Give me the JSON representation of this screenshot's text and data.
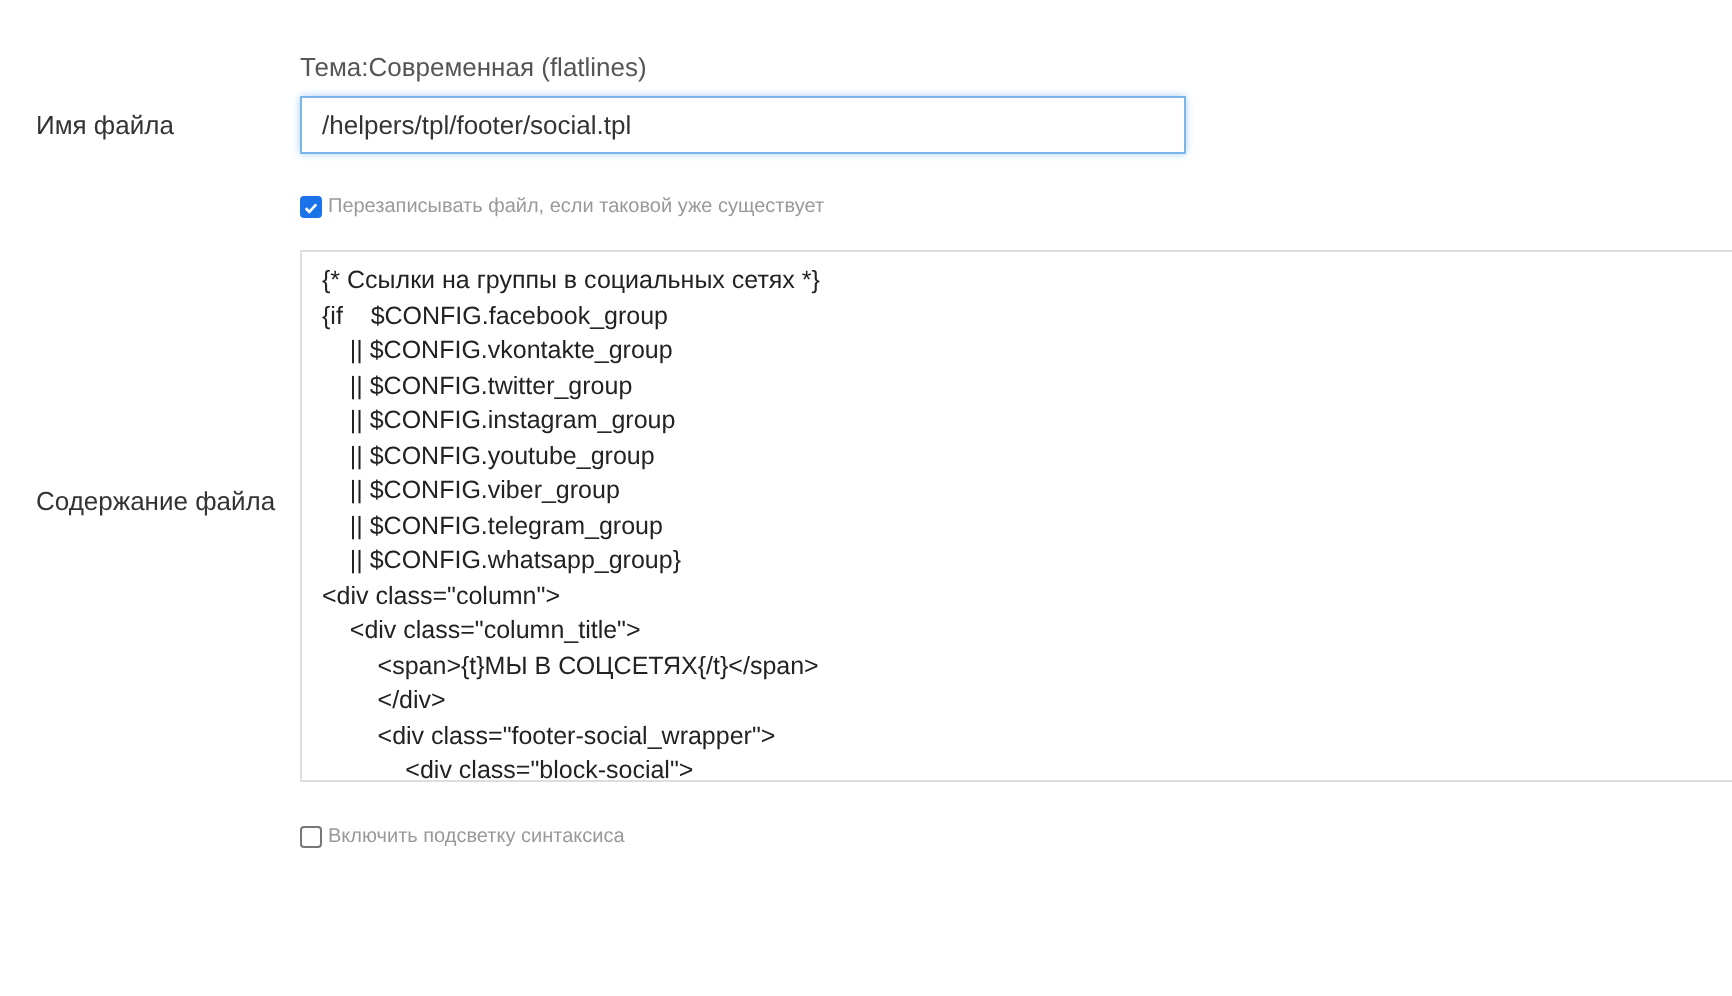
{
  "theme_caption": "Тема:Современная (flatlines)",
  "file_name": {
    "label": "Имя файла",
    "value": "/helpers/tpl/footer/social.tpl"
  },
  "overwrite": {
    "label": "Перезаписывать файл, если таковой уже существует",
    "checked": true
  },
  "content": {
    "label": "Содержание файла",
    "lines": [
      "{* Ссылки на группы в социальных сетях *}",
      "{if    $CONFIG.facebook_group",
      "    || $CONFIG.vkontakte_group",
      "    || $CONFIG.twitter_group",
      "    || $CONFIG.instagram_group",
      "    || $CONFIG.youtube_group",
      "    || $CONFIG.viber_group",
      "    || $CONFIG.telegram_group",
      "    || $CONFIG.whatsapp_group}",
      "<div class=\"column\">",
      "    <div class=\"column_title\">",
      "        <span>{t}МЫ В СОЦСЕТЯХ{/t}</span>",
      "        </div>",
      "        <div class=\"footer-social_wrapper\">",
      "            <div class=\"block-social\">"
    ]
  },
  "highlight": {
    "label": "Включить подсветку синтаксиса",
    "checked": false
  }
}
